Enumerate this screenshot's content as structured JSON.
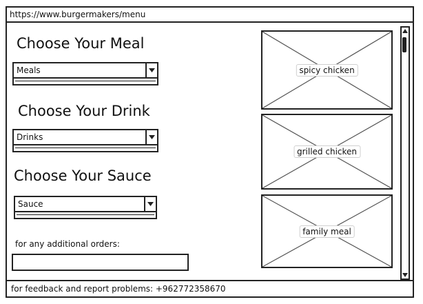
{
  "browser": {
    "url": "https://www.burgermakers/menu"
  },
  "meal": {
    "heading": "Choose Your Meal",
    "select_value": "Meals"
  },
  "drink": {
    "heading": "Choose Your Drink",
    "select_value": "Drinks"
  },
  "sauce": {
    "heading": "Choose Your Sauce",
    "select_value": "Sauce"
  },
  "additional": {
    "label": "for any additional orders:",
    "value": ""
  },
  "images": [
    {
      "label": "spicy chicken"
    },
    {
      "label": "grilled chicken"
    },
    {
      "label": "family meal"
    }
  ],
  "footer": {
    "text": "for feedback and report problems: +962772358670"
  },
  "icons": {
    "select_arrow": "caret-down-icon",
    "scroll_up": "caret-up-icon",
    "scroll_down": "caret-down-icon",
    "image_placeholder": "image-placeholder-icon"
  }
}
